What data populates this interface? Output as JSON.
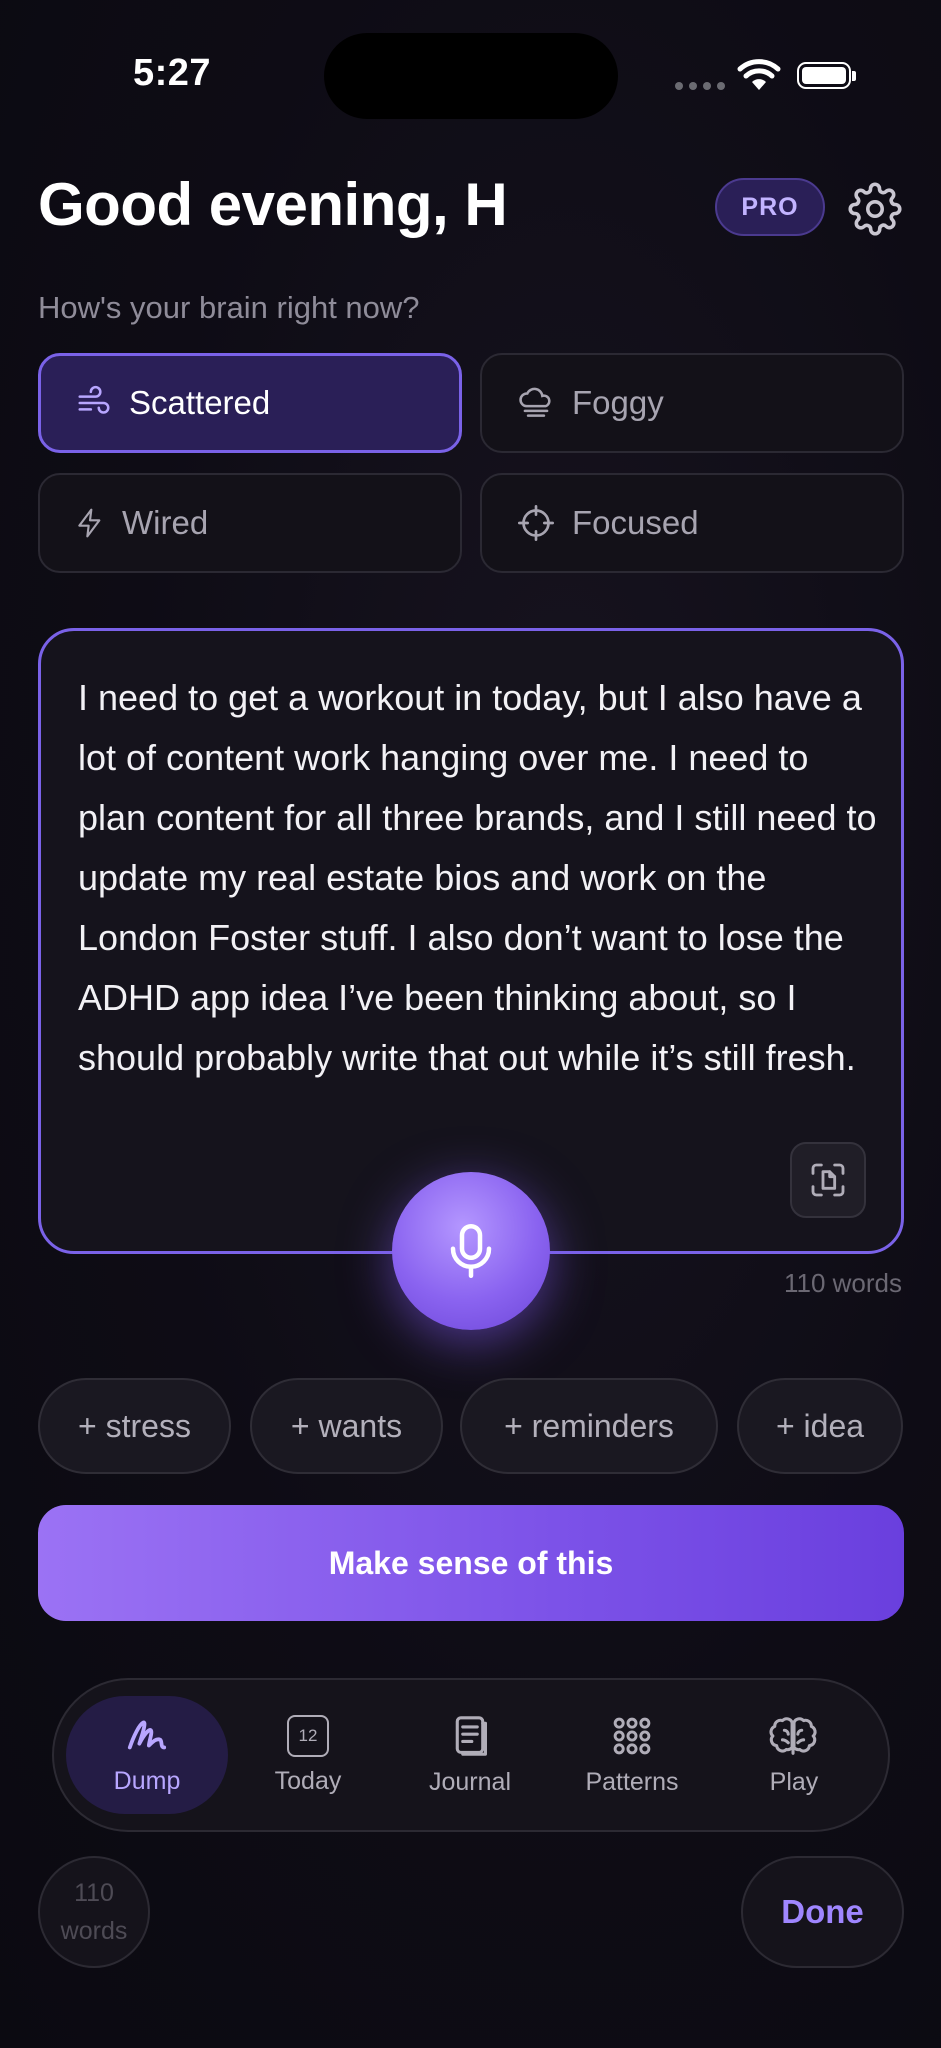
{
  "status": {
    "time": "5:27"
  },
  "header": {
    "greeting": "Good evening, H",
    "badge": "PRO"
  },
  "mood": {
    "question": "How's your brain right now?",
    "options": [
      {
        "label": "Scattered",
        "icon": "wind-icon",
        "selected": true
      },
      {
        "label": "Foggy",
        "icon": "fog-cloud-icon",
        "selected": false
      },
      {
        "label": "Wired",
        "icon": "lightning-icon",
        "selected": false
      },
      {
        "label": "Focused",
        "icon": "crosshair-icon",
        "selected": false
      }
    ]
  },
  "dump": {
    "text": "I need to get a workout in today, but I also have a lot of content work hanging over me. I need to plan content for all three brands, and I still need to update my real estate bios and work on the London Foster stuff. I also don’t want to lose the ADHD app idea I’ve been thinking about, so I should probably write that out while it’s still fresh.",
    "word_count": "110 words"
  },
  "chips": [
    "+ stress",
    "+ wants",
    "+ reminders",
    "+ idea"
  ],
  "cta": "Make sense of this",
  "tabs": [
    {
      "label": "Dump",
      "icon": "scribble-icon",
      "active": true
    },
    {
      "label": "Today",
      "icon": "calendar-icon",
      "badge": "12",
      "active": false
    },
    {
      "label": "Journal",
      "icon": "notebook-icon",
      "active": false
    },
    {
      "label": "Patterns",
      "icon": "dot-grid-icon",
      "active": false
    },
    {
      "label": "Play",
      "icon": "brain-icon",
      "active": false
    }
  ],
  "bottom": {
    "count_number": "110",
    "count_unit": "words",
    "done": "Done"
  },
  "colors": {
    "accent": "#7a62e8",
    "accent_light": "#b8a6ff",
    "background": "#0e0c15"
  }
}
